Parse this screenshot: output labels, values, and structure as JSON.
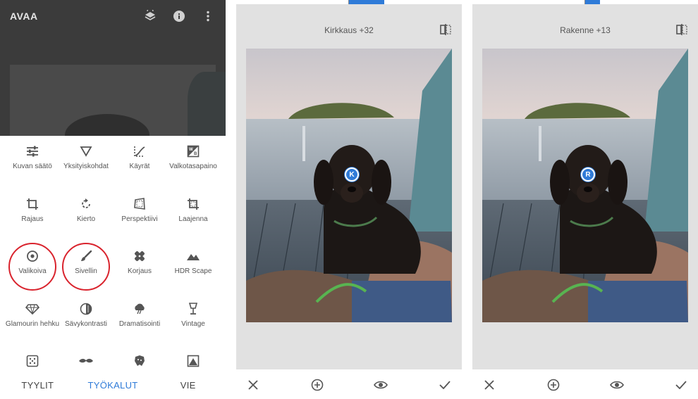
{
  "panel1": {
    "app_title": "AVAA",
    "tools": [
      {
        "label": "Kuvan säätö",
        "icon": "tune-icon"
      },
      {
        "label": "Yksityiskohdat",
        "icon": "details-icon"
      },
      {
        "label": "Käyrät",
        "icon": "curves-icon"
      },
      {
        "label": "Valkotasapaino",
        "icon": "white-balance-icon"
      },
      {
        "label": "Rajaus",
        "icon": "crop-icon"
      },
      {
        "label": "Kierto",
        "icon": "rotate-icon"
      },
      {
        "label": "Perspektiivi",
        "icon": "perspective-icon"
      },
      {
        "label": "Laajenna",
        "icon": "expand-icon"
      },
      {
        "label": "Valikoiva",
        "icon": "selective-icon"
      },
      {
        "label": "Sivellin",
        "icon": "brush-icon"
      },
      {
        "label": "Korjaus",
        "icon": "healing-icon"
      },
      {
        "label": "HDR Scape",
        "icon": "hdr-icon"
      },
      {
        "label": "Glamourin hehku",
        "icon": "glamour-icon"
      },
      {
        "label": "Sävykontrasti",
        "icon": "tonal-contrast-icon"
      },
      {
        "label": "Dramatisointi",
        "icon": "drama-icon"
      },
      {
        "label": "Vintage",
        "icon": "vintage-icon"
      }
    ],
    "bottom_tabs": [
      {
        "label": "TYYLIT",
        "active": false
      },
      {
        "label": "TYÖKALUT",
        "active": true
      },
      {
        "label": "VIE",
        "active": false
      }
    ]
  },
  "editor1": {
    "value_label": "Kirkkaus +32",
    "pin_letter": "K"
  },
  "editor2": {
    "value_label": "Rakenne +13",
    "pin_letter": "R"
  },
  "colors": {
    "accent": "#2f7bd8",
    "highlight_ring": "#d9232d"
  }
}
